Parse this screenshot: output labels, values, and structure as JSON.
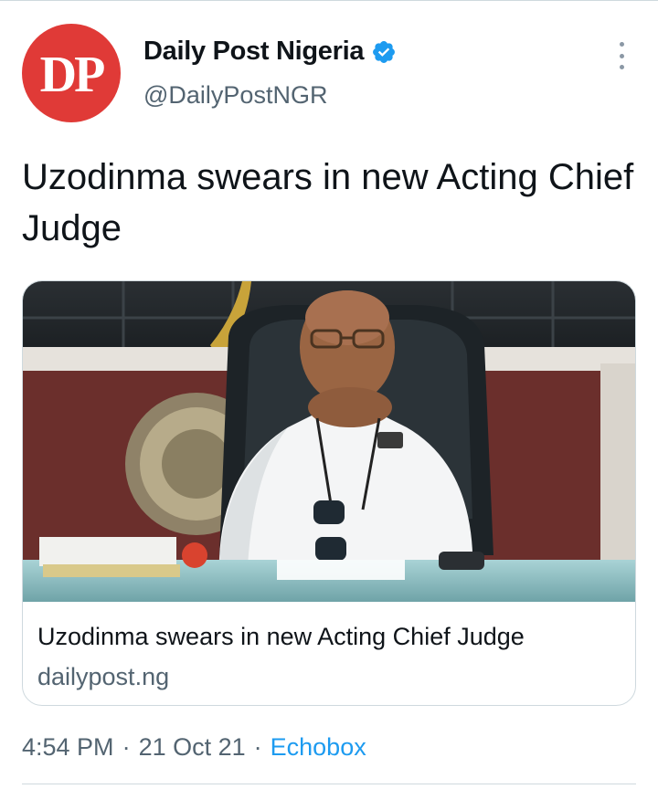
{
  "author": {
    "avatar_text": "DP",
    "display_name": "Daily Post Nigeria",
    "handle": "@DailyPostNGR",
    "verified": true
  },
  "tweet": {
    "text": "Uzodinma swears in new Acting Chief Judge"
  },
  "link_card": {
    "image_icon": "photo-man-at-desk",
    "title": "Uzodinma swears in new Acting Chief Judge",
    "domain": "dailypost.ng"
  },
  "meta": {
    "time": "4:54 PM",
    "separator": "·",
    "date": "21 Oct 21",
    "source": "Echobox"
  },
  "colors": {
    "avatar_bg": "#e03a37",
    "verified": "#1d9bf0",
    "link": "#1d9bf0",
    "secondary_text": "#536471"
  }
}
